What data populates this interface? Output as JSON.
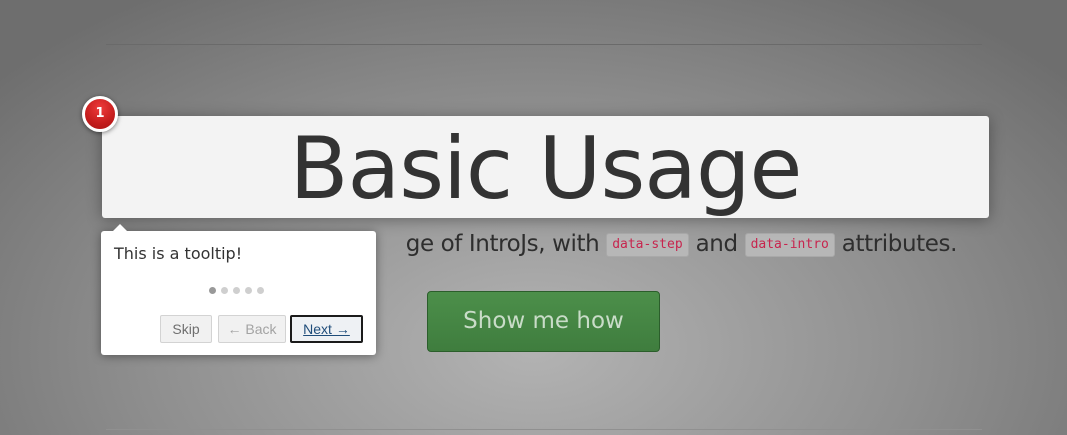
{
  "title": "Basic Usage",
  "lead": {
    "text_visible": "ge of IntroJs, with",
    "code_step": "data-step",
    "and_text": "and",
    "code_intro": "data-intro",
    "suffix": "attributes."
  },
  "cta_button_label": "Show me how",
  "intro": {
    "step_number": "1",
    "tooltip_text": "This is a tooltip!",
    "total_steps": 5,
    "current_step": 1,
    "buttons": {
      "skip": "Skip",
      "back": "← Back",
      "next": "Next →"
    }
  },
  "colors": {
    "step_badge": "#d42a2a",
    "cta_green": "#458a44",
    "code_text": "#c7254e"
  }
}
